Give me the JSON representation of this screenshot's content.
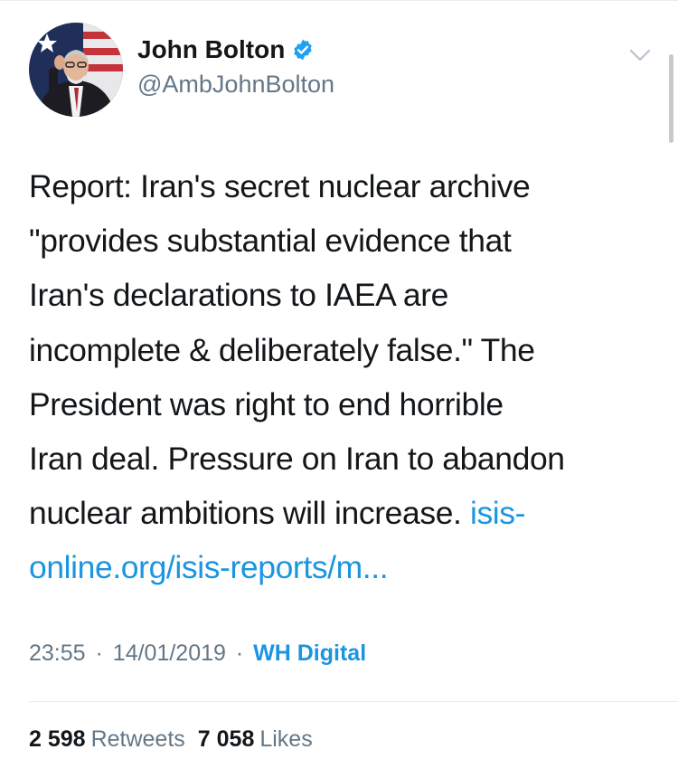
{
  "author": {
    "display_name": "John Bolton",
    "handle": "@AmbJohnBolton",
    "verified": true,
    "verified_icon": "verified-badge-icon",
    "menu_icon": "chevron-down-icon"
  },
  "tweet": {
    "lines": [
      "Report: Iran's secret nuclear archive",
      "\"provides substantial evidence that",
      "Iran's declarations to IAEA are",
      "incomplete & deliberately false.\" The",
      "President was right to end horrible",
      "Iran deal. Pressure on Iran to abandon"
    ],
    "last_text": "nuclear ambitions will increase. ",
    "link_part1": "isis-",
    "link_part2": "online.org/isis-reports/m..."
  },
  "meta": {
    "time": "23:55",
    "separator": "·",
    "date": "14/01/2019",
    "source": "WH Digital"
  },
  "stats": {
    "retweets_count": "2 598",
    "retweets_label": "Retweets",
    "likes_count": "7 058",
    "likes_label": "Likes"
  },
  "colors": {
    "link": "#1b95e0",
    "secondary_text": "#657786",
    "primary_text": "#14171a"
  }
}
